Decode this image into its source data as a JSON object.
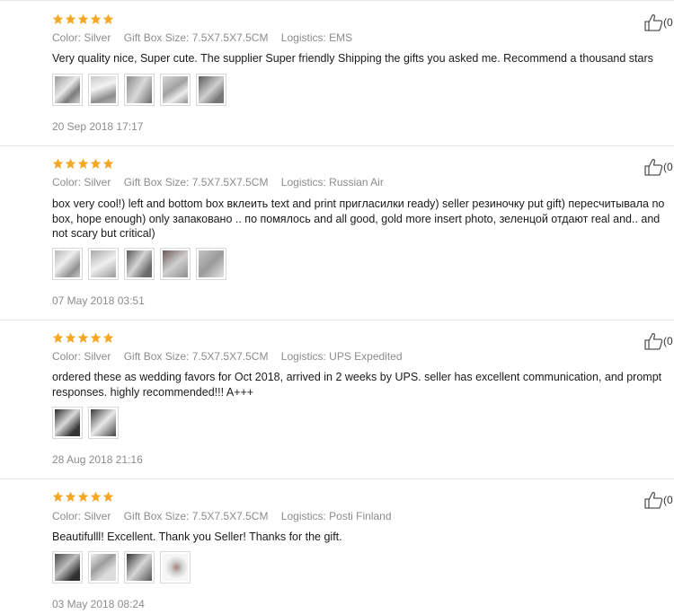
{
  "colors": {
    "star": "#f5a623",
    "meta": "#8c8c8c",
    "divider": "#e6e6e6"
  },
  "reviews": [
    {
      "rating": 5,
      "color": "Color: Silver",
      "size": "Gift Box Size: 7.5X7.5X7.5CM",
      "logistics": "Logistics: EMS",
      "text": "Very quality nice, Super cute. The supplier Super friendly Shipping the gifts you asked me. Recommend a thousand stars",
      "date": "20 Sep 2018 17:17",
      "helpful": "(0",
      "photo_count": 5
    },
    {
      "rating": 5,
      "color": "Color: Silver",
      "size": "Gift Box Size: 7.5X7.5X7.5CM",
      "logistics": "Logistics: Russian Air",
      "text": "box very cool!) left and bottom box вклеить text and print пригласилки ready) seller резиночку put gift) пересчитывала no box, hope enough) only запаковано .. по помялось and all good, gold more insert photo, зеленцой отдают real and.. and not scary but critical)",
      "date": "07 May 2018 03:51",
      "helpful": "(0",
      "photo_count": 5
    },
    {
      "rating": 5,
      "color": "Color: Silver",
      "size": "Gift Box Size: 7.5X7.5X7.5CM",
      "logistics": "Logistics: UPS Expedited",
      "text": "ordered these as wedding favors for Oct 2018, arrived in 2 weeks by UPS. seller has excellent communication, and prompt responses. highly recommended!!! A+++",
      "date": "28 Aug 2018 21:16",
      "helpful": "(0",
      "photo_count": 2
    },
    {
      "rating": 5,
      "color": "Color: Silver",
      "size": "Gift Box Size: 7.5X7.5X7.5CM",
      "logistics": "Logistics: Posti Finland",
      "text": "Beautifulll! Excellent. Thank you Seller! Thanks for the gift.",
      "date": "03 May 2018 08:24",
      "helpful": "(0",
      "photo_count": 4
    }
  ]
}
